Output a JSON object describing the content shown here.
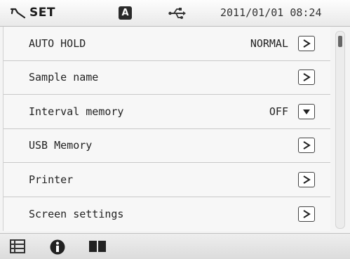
{
  "header": {
    "title": "SET",
    "tool_icon": "wrench-icon",
    "mode_badge": "A",
    "usb_icon": "usb-icon",
    "datetime": "2011/01/01 08:24"
  },
  "settings": {
    "items": [
      {
        "label": "AUTO HOLD",
        "value": "NORMAL",
        "control": "chevron-right-icon"
      },
      {
        "label": "Sample name",
        "value": "",
        "control": "chevron-right-icon"
      },
      {
        "label": "Interval memory",
        "value": "OFF",
        "control": "dropdown-arrow-icon"
      },
      {
        "label": "USB Memory",
        "value": "",
        "control": "chevron-right-icon"
      },
      {
        "label": "Printer",
        "value": "",
        "control": "chevron-right-icon"
      },
      {
        "label": "Screen settings",
        "value": "",
        "control": "chevron-right-icon"
      }
    ]
  },
  "footer": {
    "icons": [
      "list-icon",
      "info-icon",
      "book-icon"
    ]
  },
  "colors": {
    "background": "#f4f4f4",
    "header": "#ececec",
    "divider": "#c9c9c9",
    "text": "#222222"
  }
}
